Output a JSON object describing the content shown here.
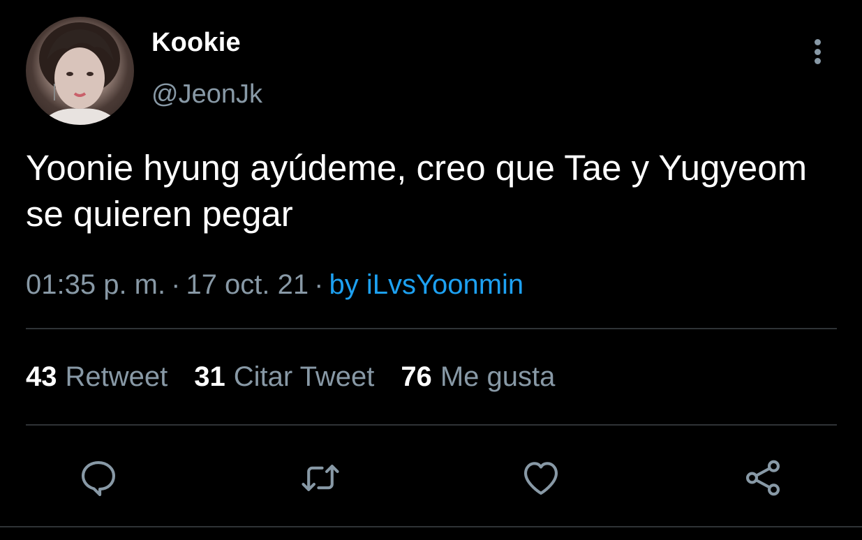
{
  "author": {
    "display_name": "Kookie",
    "handle": "@JeonJk"
  },
  "tweet": {
    "text": "Yoonie hyung ayúdeme, creo que Tae y Yugyeom se quieren pegar",
    "time": "01:35 p. m.",
    "date": "17 oct. 21",
    "separator": "·",
    "source": "by iLvsYoonmin"
  },
  "stats": {
    "retweets": {
      "count": "43",
      "label": "Retweet"
    },
    "quotes": {
      "count": "31",
      "label": "Citar Tweet"
    },
    "likes": {
      "count": "76",
      "label": "Me gusta"
    }
  },
  "icons": {
    "more": "more-vertical-icon",
    "reply": "reply-icon",
    "retweet": "retweet-icon",
    "like": "heart-icon",
    "share": "share-icon"
  },
  "colors": {
    "background": "#000000",
    "text_primary": "#ffffff",
    "text_secondary": "#8899a6",
    "link": "#1da1f2",
    "divider": "#2f3336"
  }
}
